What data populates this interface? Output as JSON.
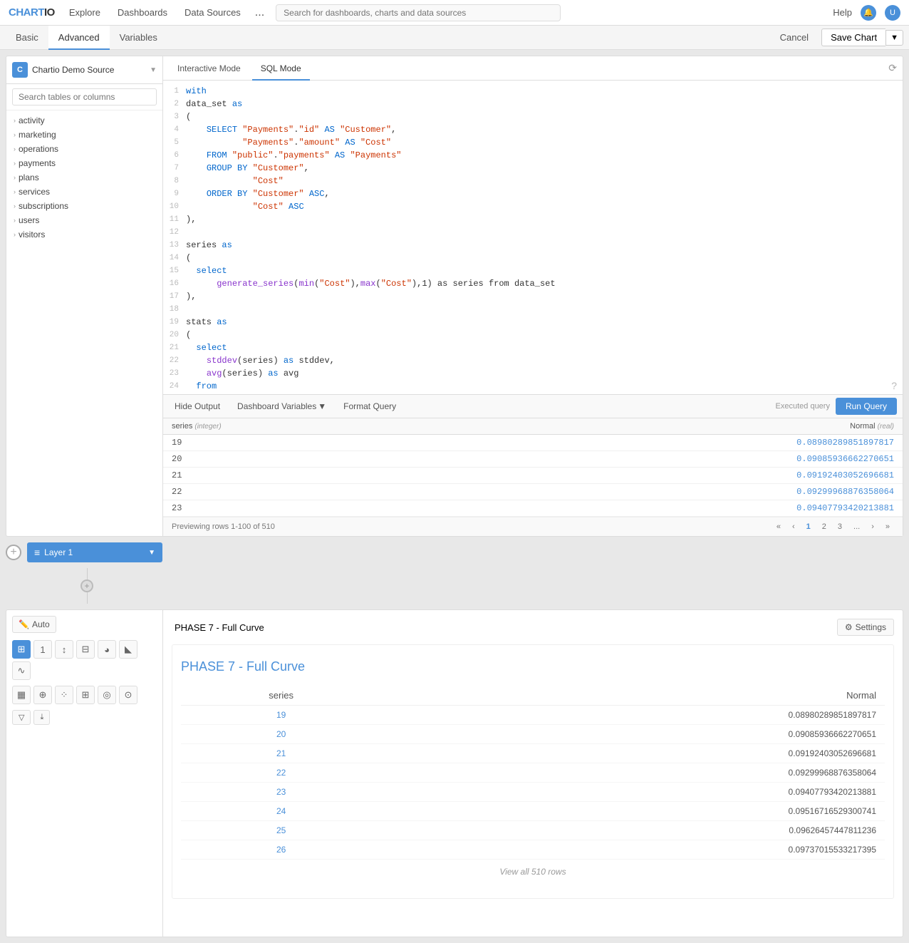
{
  "topNav": {
    "logo": "CHARTIO",
    "links": [
      "Explore",
      "Dashboards",
      "Data Sources",
      "..."
    ],
    "searchPlaceholder": "Search for dashboards, charts and data sources",
    "helpLabel": "Help",
    "userInitials": "U"
  },
  "tabBar": {
    "tabs": [
      "Basic",
      "Advanced",
      "Variables"
    ],
    "activeTab": "Advanced",
    "cancelLabel": "Cancel",
    "saveChartLabel": "Save Chart"
  },
  "leftPanel": {
    "sourceName": "Chartio Demo Source",
    "sourceInitials": "C",
    "searchPlaceholder": "Search tables or columns",
    "tables": [
      "activity",
      "marketing",
      "operations",
      "payments",
      "plans",
      "services",
      "subscriptions",
      "users",
      "visitors"
    ]
  },
  "sqlEditor": {
    "tabs": [
      "Interactive Mode",
      "SQL Mode"
    ],
    "activeTab": "SQL Mode",
    "codeLines": [
      "with",
      "data_set as",
      "(",
      "  SELECT \"Payments\".\"id\" AS \"Customer\",",
      "         \"Payments\".\"amount\" AS \"Cost\"",
      "  FROM \"public\".\"payments\" AS \"Payments\"",
      "  GROUP BY \"Customer\",",
      "           \"Cost\"",
      "  ORDER BY \"Customer\" ASC,",
      "           \"Cost\" ASC",
      "),",
      "",
      "series as",
      "(",
      "  select",
      "      generate_series(min(\"Cost\"),max(\"Cost\"),1) as series from data_set",
      "),",
      "",
      "stats as",
      "(",
      "  select",
      "    stddev(series) as stddev,",
      "    avg(series) as avg",
      "  from"
    ]
  },
  "queryToolbar": {
    "hideOutputLabel": "Hide Output",
    "dashboardVariablesLabel": "Dashboard Variables",
    "formatQueryLabel": "Format Query",
    "executedLabel": "Executed query",
    "runQueryLabel": "Run Query"
  },
  "resultsTable": {
    "columns": [
      {
        "name": "series",
        "type": "integer"
      },
      {
        "name": "Normal",
        "type": "real"
      }
    ],
    "rows": [
      {
        "series": "19",
        "normal": "0.08980289851897817"
      },
      {
        "series": "20",
        "normal": "0.09085936662270651"
      },
      {
        "series": "21",
        "normal": "0.09192403052696681"
      },
      {
        "series": "22",
        "normal": "0.09299968876358064"
      },
      {
        "series": "23",
        "normal": "0.09407793420213881"
      }
    ],
    "previewText": "Previewing rows 1-100 of 510",
    "pagination": {
      "first": "«",
      "prev": "‹",
      "pages": [
        "1",
        "2",
        "3",
        "..."
      ],
      "next": "›",
      "last": "»"
    }
  },
  "layerBar": {
    "layerName": "Layer 1"
  },
  "chartControls": {
    "autoLabel": "Auto"
  },
  "chartDisplay": {
    "titleValue": "PHASE 7 - Full Curve",
    "settingsLabel": "Settings",
    "heading": "PHASE 7 - Full Curve",
    "headingPlain": "PHASE 7 - ",
    "headingHighlight": "Full Curve",
    "columns": [
      "series",
      "Normal"
    ],
    "rows": [
      {
        "series": "19",
        "normal": "0.08980289851897817"
      },
      {
        "series": "20",
        "normal": "0.09085936662270651"
      },
      {
        "series": "21",
        "normal": "0.09192403052696681"
      },
      {
        "series": "22",
        "normal": "0.09299968876358064"
      },
      {
        "series": "23",
        "normal": "0.09407793420213881"
      },
      {
        "series": "24",
        "normal": "0.09516716529300741"
      },
      {
        "series": "25",
        "normal": "0.09626457447811236"
      },
      {
        "series": "26",
        "normal": "0.09737015533217395"
      }
    ],
    "viewAllLabel": "View all 510 rows"
  }
}
